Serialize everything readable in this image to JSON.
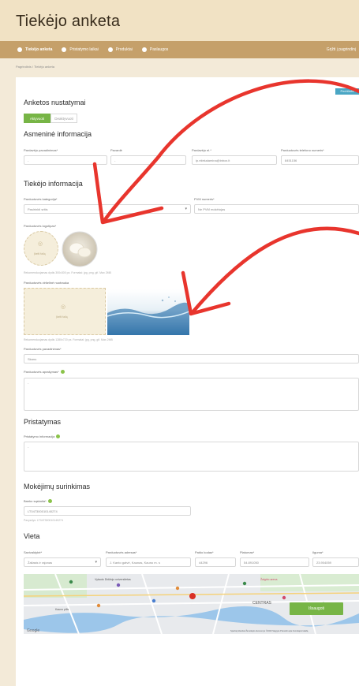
{
  "header": {
    "title": "Tiekėjo anketa"
  },
  "nav": {
    "items": [
      {
        "label": "Tiekėjo anketa"
      },
      {
        "label": "Pristatymo laikai"
      },
      {
        "label": "Produktai"
      },
      {
        "label": "Paslaugos"
      }
    ],
    "right": "Grįžti į pagrindinį"
  },
  "breadcrumb": "Pagrindinis  /  Tiekėjo anketa",
  "settings": {
    "title": "Anketos nustatymai",
    "toggle_active": "Aktyvuoti",
    "toggle_inactive": "Deaktyvuoti",
    "badge": "Peržiūrėti"
  },
  "personal": {
    "title": "Asmeninė informacija",
    "name_label": "Pardavėjo pavadinimas*",
    "name_value": "-",
    "surname_label": "Pavardė",
    "surname_value": "-",
    "email_label": "Pardavėjo el.*",
    "email_value": "ip.ntiekalamina@inbox.lt",
    "phone_label": "Parduotuvės telefono numeris*",
    "phone_value": "8451156"
  },
  "supplier": {
    "title": "Tiekėjo informacija",
    "category_label": "Parduotuvės kategorija*",
    "category_placeholder": "Pasirinkti sritis",
    "pvm_label": "PVM numeris*",
    "pvm_value": "Ne PVM mokėtojas",
    "logo_label": "Parduotuvės logotipas*",
    "logo_upload": "Įkelti failą",
    "logo_hint": "Rekomenduojamas dydis 300x300 px. Formatai: jpg, png, gif. Max 2MB",
    "cover_label": "Parduotuvės viršelinė nuotrauka",
    "cover_upload": "Įkelti failą",
    "cover_hint": "Rekomenduojamas dydis 1280x720 px. Formatai: jpg, png, gif. Max 2MB",
    "shop_name_label": "Parduotuvės pavadinimas*",
    "shop_name_value": "Skanu",
    "description_label": "Parduotuvės aprašymas*",
    "description_value": "-"
  },
  "delivery": {
    "title": "Pristatymas",
    "info_label": "Pristatymo informacija",
    "info_value": "-"
  },
  "payments": {
    "title": "Mokėjimų surinkimas",
    "bank_label": "Banko sąskaita*",
    "bank_value": "LT047300010140274",
    "bank_hint": "Pavyzdys: LT047300010140274"
  },
  "location": {
    "title": "Vieta",
    "city_label": "Savivaldybė*",
    "city_value": "Žaliasis ir rajonas",
    "address_label": "Parduotuvės adresas*",
    "address_value": "J. Kanto gatvė, Kaunas, Kauno m. s",
    "postal_label": "Pašto kodas*",
    "postal_value": "44296",
    "lat_label": "Platumas*",
    "lat_value": "54.891050",
    "lng_label": "Ilguma*",
    "lng_value": "23.904059"
  },
  "map": {
    "labels": [
      "CENTRAS",
      "Google",
      "Žalgirio arena",
      "Kauno pilis",
      "Vytauto Didžiojo universitetas"
    ],
    "footer": "Spartieji klavišai  Žemėlapio duomenys ©2023  Sąlygos  Pranešti apie žemėlapio klaidą"
  },
  "save_button": "Išsaugoti",
  "colors": {
    "annotation": "#e8352d",
    "nav": "#c5a06a",
    "save": "#77b546",
    "active_toggle": "#77b546"
  }
}
